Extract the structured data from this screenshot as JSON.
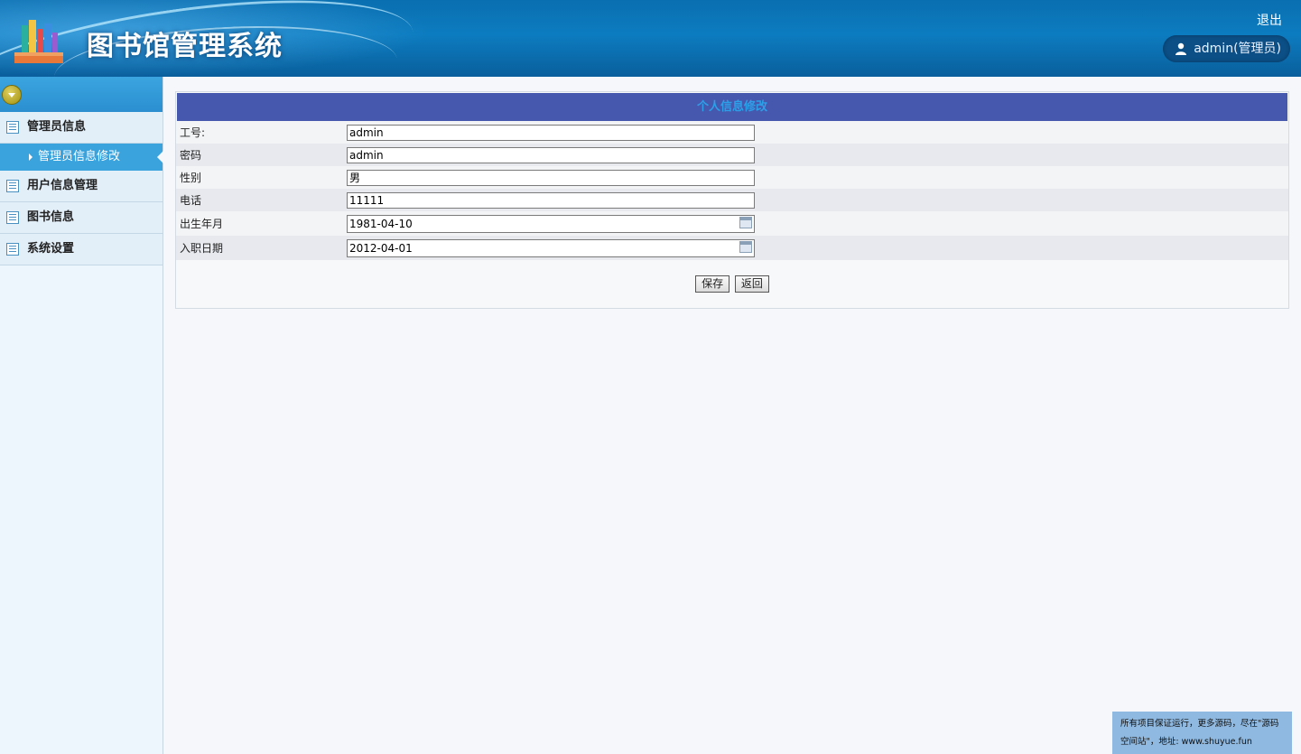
{
  "header": {
    "app_title": "图书馆管理系统",
    "logout_label": "退出",
    "user_label": "admin(管理员)"
  },
  "sidebar": {
    "items": [
      {
        "label": "管理员信息",
        "icon": "list-icon",
        "expanded": true,
        "children": [
          {
            "label": "管理员信息修改",
            "active": true
          }
        ]
      },
      {
        "label": "用户信息管理",
        "icon": "list-icon"
      },
      {
        "label": "图书信息",
        "icon": "list-icon"
      },
      {
        "label": "系统设置",
        "icon": "list-icon"
      }
    ]
  },
  "form": {
    "title": "个人信息修改",
    "fields": [
      {
        "label": "工号:",
        "value": "admin"
      },
      {
        "label": "密码",
        "value": "admin"
      },
      {
        "label": "性别",
        "value": "男"
      },
      {
        "label": "电话",
        "value": "11111"
      },
      {
        "label": "出生年月",
        "value": "1981-04-10",
        "has_calendar": true
      },
      {
        "label": "入职日期",
        "value": "2012-04-01",
        "has_calendar": true
      }
    ],
    "save_label": "保存",
    "back_label": "返回"
  },
  "ad": {
    "line1": "所有项目保证运行，更多源码，尽在\"源码",
    "line2": "空间站\"，地址: www.shuyue.fun"
  },
  "colors": {
    "header_bg": "#0a6fb0",
    "panel_title_bg": "#4658ad",
    "active_menu_bg": "#3aa2dc"
  }
}
